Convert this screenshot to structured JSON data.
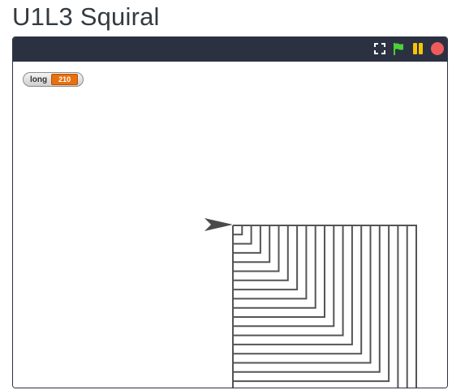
{
  "page": {
    "title": "U1L3 Squiral"
  },
  "toolbar": {
    "buttons": [
      {
        "name": "fullscreen-icon",
        "color": "#ffffff"
      },
      {
        "name": "green-flag-icon",
        "color": "#4cd137"
      },
      {
        "name": "pause-icon",
        "color": "#f7c600"
      },
      {
        "name": "stop-icon",
        "color": "#ef5b5b"
      }
    ]
  },
  "stage": {
    "watcher": {
      "label": "long",
      "value": "210"
    },
    "drawing": {
      "pen_color": "#555555",
      "sprite_color": "#4a4a4a"
    }
  },
  "colors": {
    "toolbar_bg": "#2c3142",
    "title_text": "#333a40",
    "stage_bg": "#ffffff"
  }
}
